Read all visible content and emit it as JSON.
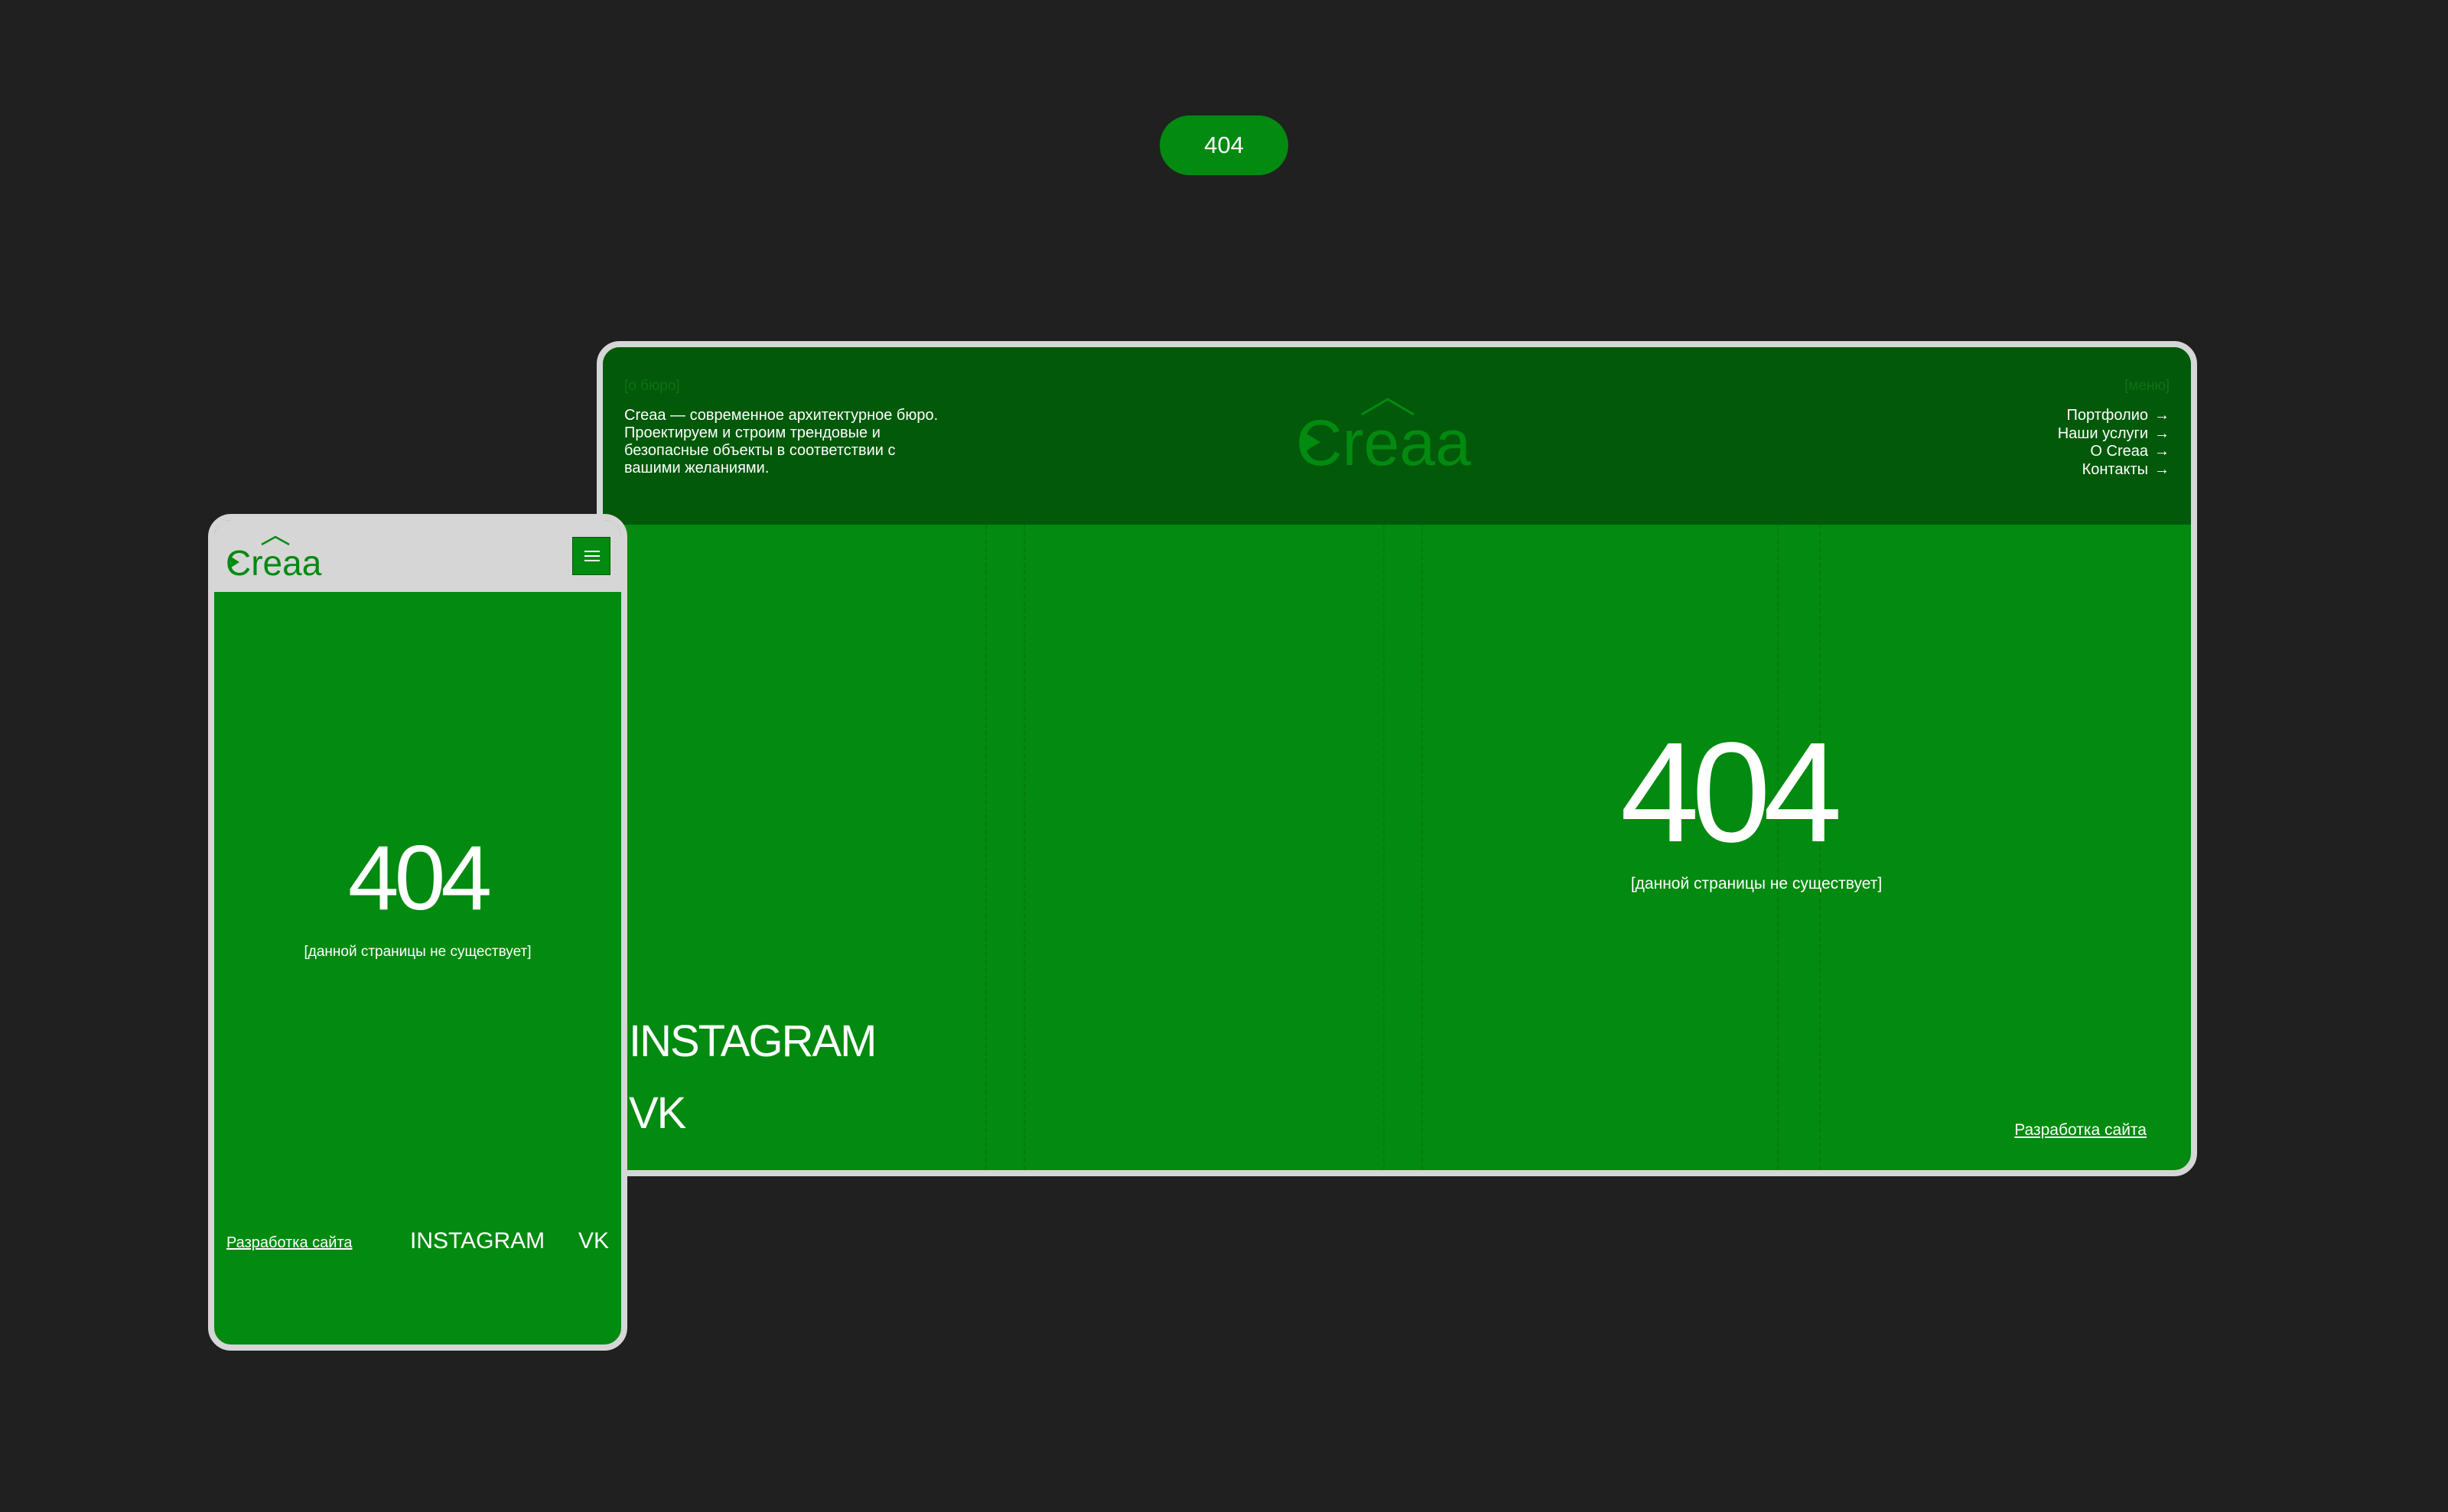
{
  "badge": {
    "label": "404"
  },
  "colors": {
    "background": "#202020",
    "brand_green": "#038a10",
    "dark_green": "#02590a",
    "frame_gray": "#d6d6d6",
    "text": "#ffffff"
  },
  "desktop": {
    "about_label": "[о бюро]",
    "about_text": "Creaa — современное архитектурное бюро. Проектируем и строим трендовые и безопасные объекты в соответствии с вашими желаниями.",
    "logo_text": "Creaa",
    "menu_label": "[меню]",
    "nav": [
      {
        "label": "Портфолио",
        "icon": "arrow-right-icon"
      },
      {
        "label": "Наши услуги",
        "icon": "arrow-right-icon"
      },
      {
        "label": "О Creaa",
        "icon": "arrow-right-icon"
      },
      {
        "label": "Контакты",
        "icon": "arrow-right-icon"
      }
    ],
    "error_code": "404",
    "error_message": "[данной страницы не существует]",
    "social": {
      "instagram": "INSTAGRAM",
      "vk": "VK"
    },
    "dev_link": "Разработка сайта"
  },
  "mobile": {
    "logo_text": "Creaa",
    "menu_icon": "hamburger-icon",
    "error_code": "404",
    "error_message": "[данной страницы не существует]",
    "dev_link": "Разработка сайта",
    "social": {
      "instagram": "INSTAGRAM",
      "vk": "VK"
    }
  }
}
